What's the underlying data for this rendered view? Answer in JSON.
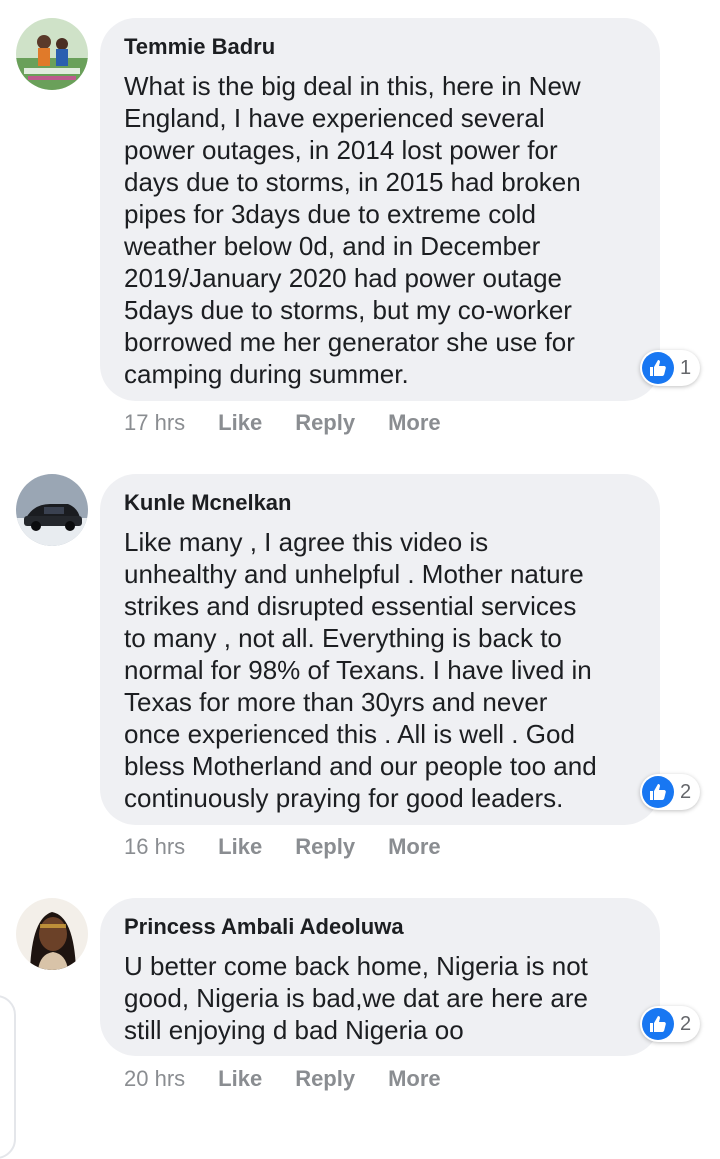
{
  "colors": {
    "bubble": "#eff0f3",
    "like_blue": "#1877f2",
    "meta_text": "#8a8d91"
  },
  "comments": [
    {
      "author": "Temmie Badru",
      "text": "What is the big deal in this, here in New\nEngland, I have experienced several\npower outages, in 2014 lost power for\ndays due to storms, in 2015 had broken\npipes for 3days due to extreme cold\nweather below 0d, and in December\n2019/January 2020 had power outage\n5days due to storms, but my co-worker\nborrowed me her generator she use for\ncamping during summer.",
      "reaction_icon": "like-icon",
      "reaction_count": "1",
      "time": "17 hrs",
      "like_label": "Like",
      "reply_label": "Reply",
      "more_label": "More"
    },
    {
      "author": "Kunle Mcnelkan",
      "text": "Like many , I agree this video is\nunhealthy and unhelpful . Mother nature\nstrikes and disrupted essential services\nto many , not all. Everything is back to\nnormal for 98% of Texans. I have lived in\nTexas for more than 30yrs and never\nonce experienced this . All is well . God\nbless Motherland and our people too and\ncontinuously praying for good leaders.",
      "reaction_icon": "like-icon",
      "reaction_count": "2",
      "time": "16 hrs",
      "like_label": "Like",
      "reply_label": "Reply",
      "more_label": "More"
    },
    {
      "author": "Princess Ambali Adeoluwa",
      "text": "U better come back home, Nigeria is not\ngood, Nigeria is bad,we dat are here are\nstill enjoying d bad Nigeria oo",
      "reaction_icon": "like-icon",
      "reaction_count": "2",
      "time": "20 hrs",
      "like_label": "Like",
      "reply_label": "Reply",
      "more_label": "More"
    }
  ]
}
